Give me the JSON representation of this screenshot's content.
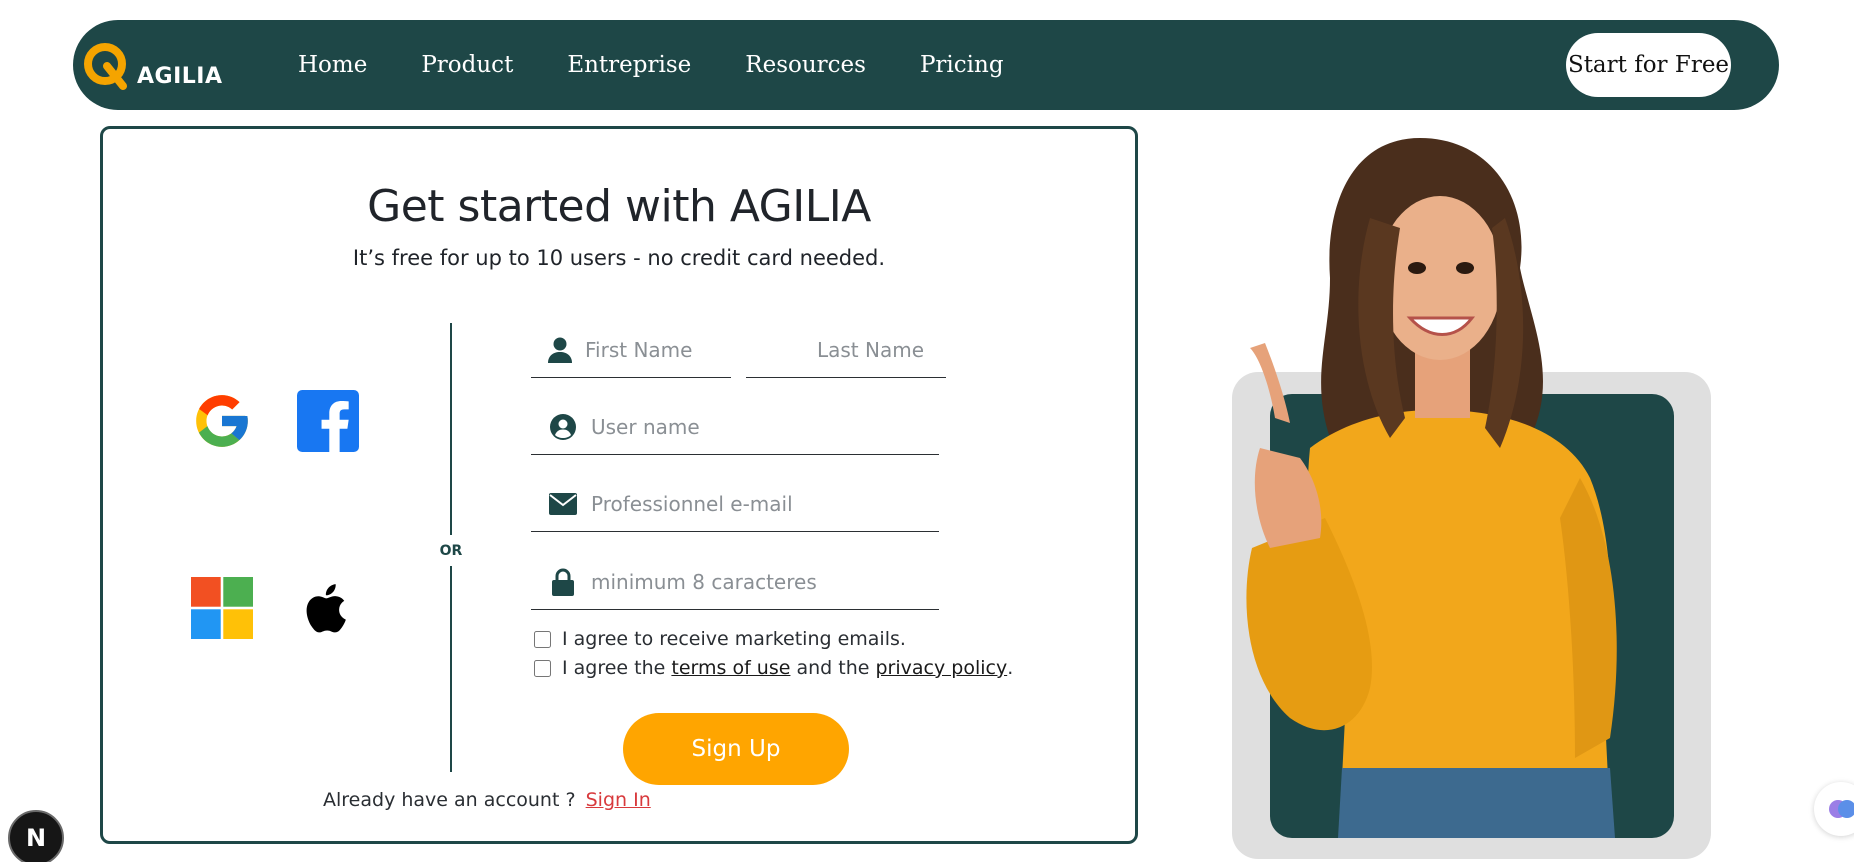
{
  "brand": {
    "logo_text": "AGILIA",
    "color": "#1e4747",
    "accent": "#ffa500"
  },
  "nav": {
    "links": [
      "Home",
      "Product",
      "Entreprise",
      "Resources",
      "Pricing"
    ],
    "cta": "Start for Free"
  },
  "signup_card": {
    "title": "Get started with AGILIA",
    "subtitle": "It’s free for up to 10 users - no credit card needed.",
    "social_providers": [
      "google-icon",
      "facebook-icon",
      "microsoft-icon",
      "apple-icon"
    ],
    "divider_text": "OR",
    "fields": {
      "first_name": {
        "placeholder": "First Name",
        "value": ""
      },
      "last_name": {
        "placeholder": "Last Name",
        "value": ""
      },
      "username": {
        "placeholder": "User name",
        "value": ""
      },
      "email": {
        "placeholder": "Professionnel e-mail",
        "value": ""
      },
      "password": {
        "placeholder": "minimum 8 caracteres",
        "value": ""
      }
    },
    "checkboxes": {
      "marketing": {
        "label": "I agree to receive marketing emails.",
        "checked": false
      },
      "terms": {
        "prefix": "I agree the",
        "terms_link": "terms of use",
        "middle": "and the",
        "privacy_link": "privacy policy",
        "suffix": ".",
        "checked": false
      }
    },
    "submit_label": "Sign Up",
    "signin_prompt": "Already have an account ?",
    "signin_link": "Sign In"
  },
  "overlays": {
    "dev_badge": "N"
  }
}
